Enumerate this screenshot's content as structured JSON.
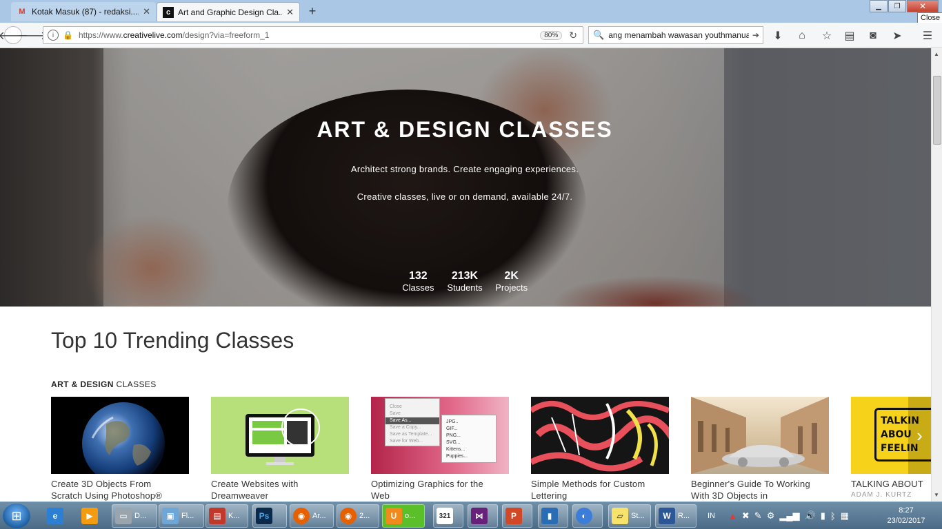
{
  "browser": {
    "tabs": [
      {
        "title": "Kotak Masuk (87) - redaksi....",
        "icon": "gmail-icon",
        "active": false
      },
      {
        "title": "Art and Graphic Design Cla...",
        "icon": "creativelive-icon",
        "active": true
      }
    ],
    "tooltip": "Close",
    "url_prefix": "https://www.",
    "url_domain": "creativelive.com",
    "url_path": "/design?via=freeform_1",
    "zoom": "80%",
    "search_value": "ang menambah wawasan youthmanual"
  },
  "hero": {
    "title": "ART & DESIGN CLASSES",
    "tagline1": "Architect strong brands. Create engaging experiences.",
    "tagline2": "Creative classes, live or on demand, available 24/7.",
    "stats": [
      {
        "value": "132",
        "label": "Classes"
      },
      {
        "value": "213K",
        "label": "Students"
      },
      {
        "value": "2K",
        "label": "Projects"
      }
    ]
  },
  "trending": {
    "title": "Top 10 Trending Classes",
    "section_bold": "ART & DESIGN",
    "section_rest": " CLASSES",
    "cards": [
      {
        "line1": "Create 3D Objects From",
        "line2": "Scratch Using Photoshop®",
        "author": ""
      },
      {
        "line1": "Create Websites with",
        "line2": "Dreamweaver",
        "author": ""
      },
      {
        "line1": "Optimizing Graphics for the",
        "line2": "Web",
        "author": ""
      },
      {
        "line1": "Simple Methods for Custom",
        "line2": "Lettering",
        "author": ""
      },
      {
        "line1": "Beginner's Guide To Working",
        "line2": "With 3D Objects in",
        "author": ""
      },
      {
        "line1": "TALKING ABOUT",
        "line2": "",
        "author": "ADAM J. KURTZ"
      }
    ],
    "card3_menu": [
      "Close",
      "Save",
      "Save As...",
      "Save a Copy...",
      "Save as Template...",
      "Save for Web..."
    ],
    "card3_submenu": [
      "JPG..",
      "GIF...",
      "PNG...",
      "SVG...",
      "Kittens...",
      "Puppies..."
    ],
    "card6_art": "TALKIN ABOU FEELIN"
  },
  "taskbar": {
    "items": [
      {
        "label": "D...",
        "icon": "drive-icon"
      },
      {
        "label": "Fl...",
        "icon": "flash-icon"
      },
      {
        "label": "K...",
        "icon": "book-icon"
      },
      {
        "label": "",
        "icon": "photoshop-icon"
      },
      {
        "label": "Ar...",
        "icon": "firefox-icon"
      },
      {
        "label": "2...",
        "icon": "firefox-icon"
      },
      {
        "label": "o...",
        "icon": "uc-browser-icon"
      },
      {
        "label": "",
        "icon": "calendar-icon"
      },
      {
        "label": "",
        "icon": "visual-studio-icon"
      },
      {
        "label": "",
        "icon": "powerpoint-icon"
      },
      {
        "label": "",
        "icon": "notebook-icon"
      },
      {
        "label": "",
        "icon": "app-icon"
      },
      {
        "label": "St...",
        "icon": "sticky-notes-icon"
      },
      {
        "label": "R...",
        "icon": "word-icon"
      }
    ],
    "lang": "IN",
    "time": "8:27",
    "date": "23/02/2017"
  }
}
